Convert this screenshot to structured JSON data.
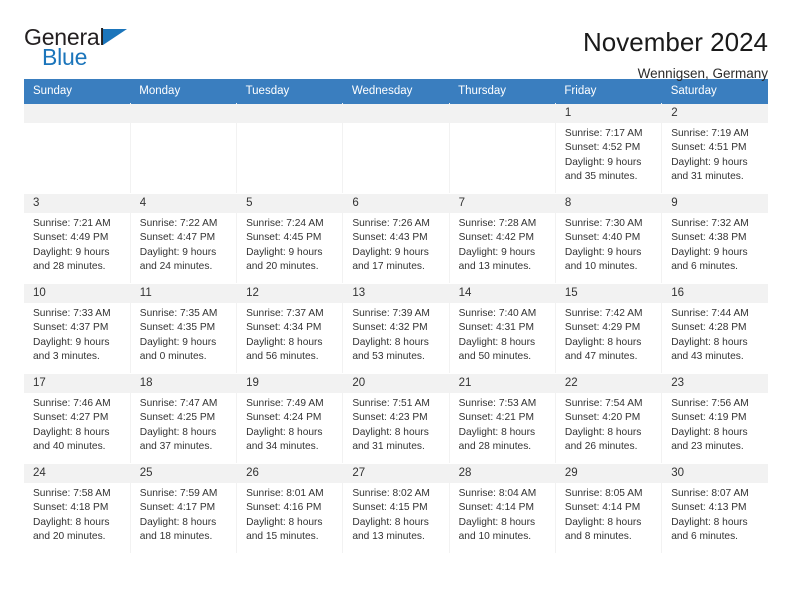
{
  "brand": {
    "word_one": "General",
    "word_two": "Blue",
    "triangle_color": "#1b75bb"
  },
  "header": {
    "title": "November 2024",
    "subtitle": "Wennigsen, Germany",
    "accent_color": "#3a7ebf",
    "daynum_strip_color": "#f2f2f2"
  },
  "weekday_headers": [
    "Sunday",
    "Monday",
    "Tuesday",
    "Wednesday",
    "Thursday",
    "Friday",
    "Saturday"
  ],
  "weeks": [
    [
      {
        "day": "",
        "lines": []
      },
      {
        "day": "",
        "lines": []
      },
      {
        "day": "",
        "lines": []
      },
      {
        "day": "",
        "lines": []
      },
      {
        "day": "",
        "lines": []
      },
      {
        "day": "1",
        "lines": [
          "Sunrise: 7:17 AM",
          "Sunset: 4:52 PM",
          "Daylight: 9 hours",
          "and 35 minutes."
        ]
      },
      {
        "day": "2",
        "lines": [
          "Sunrise: 7:19 AM",
          "Sunset: 4:51 PM",
          "Daylight: 9 hours",
          "and 31 minutes."
        ]
      }
    ],
    [
      {
        "day": "3",
        "lines": [
          "Sunrise: 7:21 AM",
          "Sunset: 4:49 PM",
          "Daylight: 9 hours",
          "and 28 minutes."
        ]
      },
      {
        "day": "4",
        "lines": [
          "Sunrise: 7:22 AM",
          "Sunset: 4:47 PM",
          "Daylight: 9 hours",
          "and 24 minutes."
        ]
      },
      {
        "day": "5",
        "lines": [
          "Sunrise: 7:24 AM",
          "Sunset: 4:45 PM",
          "Daylight: 9 hours",
          "and 20 minutes."
        ]
      },
      {
        "day": "6",
        "lines": [
          "Sunrise: 7:26 AM",
          "Sunset: 4:43 PM",
          "Daylight: 9 hours",
          "and 17 minutes."
        ]
      },
      {
        "day": "7",
        "lines": [
          "Sunrise: 7:28 AM",
          "Sunset: 4:42 PM",
          "Daylight: 9 hours",
          "and 13 minutes."
        ]
      },
      {
        "day": "8",
        "lines": [
          "Sunrise: 7:30 AM",
          "Sunset: 4:40 PM",
          "Daylight: 9 hours",
          "and 10 minutes."
        ]
      },
      {
        "day": "9",
        "lines": [
          "Sunrise: 7:32 AM",
          "Sunset: 4:38 PM",
          "Daylight: 9 hours",
          "and 6 minutes."
        ]
      }
    ],
    [
      {
        "day": "10",
        "lines": [
          "Sunrise: 7:33 AM",
          "Sunset: 4:37 PM",
          "Daylight: 9 hours",
          "and 3 minutes."
        ]
      },
      {
        "day": "11",
        "lines": [
          "Sunrise: 7:35 AM",
          "Sunset: 4:35 PM",
          "Daylight: 9 hours",
          "and 0 minutes."
        ]
      },
      {
        "day": "12",
        "lines": [
          "Sunrise: 7:37 AM",
          "Sunset: 4:34 PM",
          "Daylight: 8 hours",
          "and 56 minutes."
        ]
      },
      {
        "day": "13",
        "lines": [
          "Sunrise: 7:39 AM",
          "Sunset: 4:32 PM",
          "Daylight: 8 hours",
          "and 53 minutes."
        ]
      },
      {
        "day": "14",
        "lines": [
          "Sunrise: 7:40 AM",
          "Sunset: 4:31 PM",
          "Daylight: 8 hours",
          "and 50 minutes."
        ]
      },
      {
        "day": "15",
        "lines": [
          "Sunrise: 7:42 AM",
          "Sunset: 4:29 PM",
          "Daylight: 8 hours",
          "and 47 minutes."
        ]
      },
      {
        "day": "16",
        "lines": [
          "Sunrise: 7:44 AM",
          "Sunset: 4:28 PM",
          "Daylight: 8 hours",
          "and 43 minutes."
        ]
      }
    ],
    [
      {
        "day": "17",
        "lines": [
          "Sunrise: 7:46 AM",
          "Sunset: 4:27 PM",
          "Daylight: 8 hours",
          "and 40 minutes."
        ]
      },
      {
        "day": "18",
        "lines": [
          "Sunrise: 7:47 AM",
          "Sunset: 4:25 PM",
          "Daylight: 8 hours",
          "and 37 minutes."
        ]
      },
      {
        "day": "19",
        "lines": [
          "Sunrise: 7:49 AM",
          "Sunset: 4:24 PM",
          "Daylight: 8 hours",
          "and 34 minutes."
        ]
      },
      {
        "day": "20",
        "lines": [
          "Sunrise: 7:51 AM",
          "Sunset: 4:23 PM",
          "Daylight: 8 hours",
          "and 31 minutes."
        ]
      },
      {
        "day": "21",
        "lines": [
          "Sunrise: 7:53 AM",
          "Sunset: 4:21 PM",
          "Daylight: 8 hours",
          "and 28 minutes."
        ]
      },
      {
        "day": "22",
        "lines": [
          "Sunrise: 7:54 AM",
          "Sunset: 4:20 PM",
          "Daylight: 8 hours",
          "and 26 minutes."
        ]
      },
      {
        "day": "23",
        "lines": [
          "Sunrise: 7:56 AM",
          "Sunset: 4:19 PM",
          "Daylight: 8 hours",
          "and 23 minutes."
        ]
      }
    ],
    [
      {
        "day": "24",
        "lines": [
          "Sunrise: 7:58 AM",
          "Sunset: 4:18 PM",
          "Daylight: 8 hours",
          "and 20 minutes."
        ]
      },
      {
        "day": "25",
        "lines": [
          "Sunrise: 7:59 AM",
          "Sunset: 4:17 PM",
          "Daylight: 8 hours",
          "and 18 minutes."
        ]
      },
      {
        "day": "26",
        "lines": [
          "Sunrise: 8:01 AM",
          "Sunset: 4:16 PM",
          "Daylight: 8 hours",
          "and 15 minutes."
        ]
      },
      {
        "day": "27",
        "lines": [
          "Sunrise: 8:02 AM",
          "Sunset: 4:15 PM",
          "Daylight: 8 hours",
          "and 13 minutes."
        ]
      },
      {
        "day": "28",
        "lines": [
          "Sunrise: 8:04 AM",
          "Sunset: 4:14 PM",
          "Daylight: 8 hours",
          "and 10 minutes."
        ]
      },
      {
        "day": "29",
        "lines": [
          "Sunrise: 8:05 AM",
          "Sunset: 4:14 PM",
          "Daylight: 8 hours",
          "and 8 minutes."
        ]
      },
      {
        "day": "30",
        "lines": [
          "Sunrise: 8:07 AM",
          "Sunset: 4:13 PM",
          "Daylight: 8 hours",
          "and 6 minutes."
        ]
      }
    ]
  ]
}
